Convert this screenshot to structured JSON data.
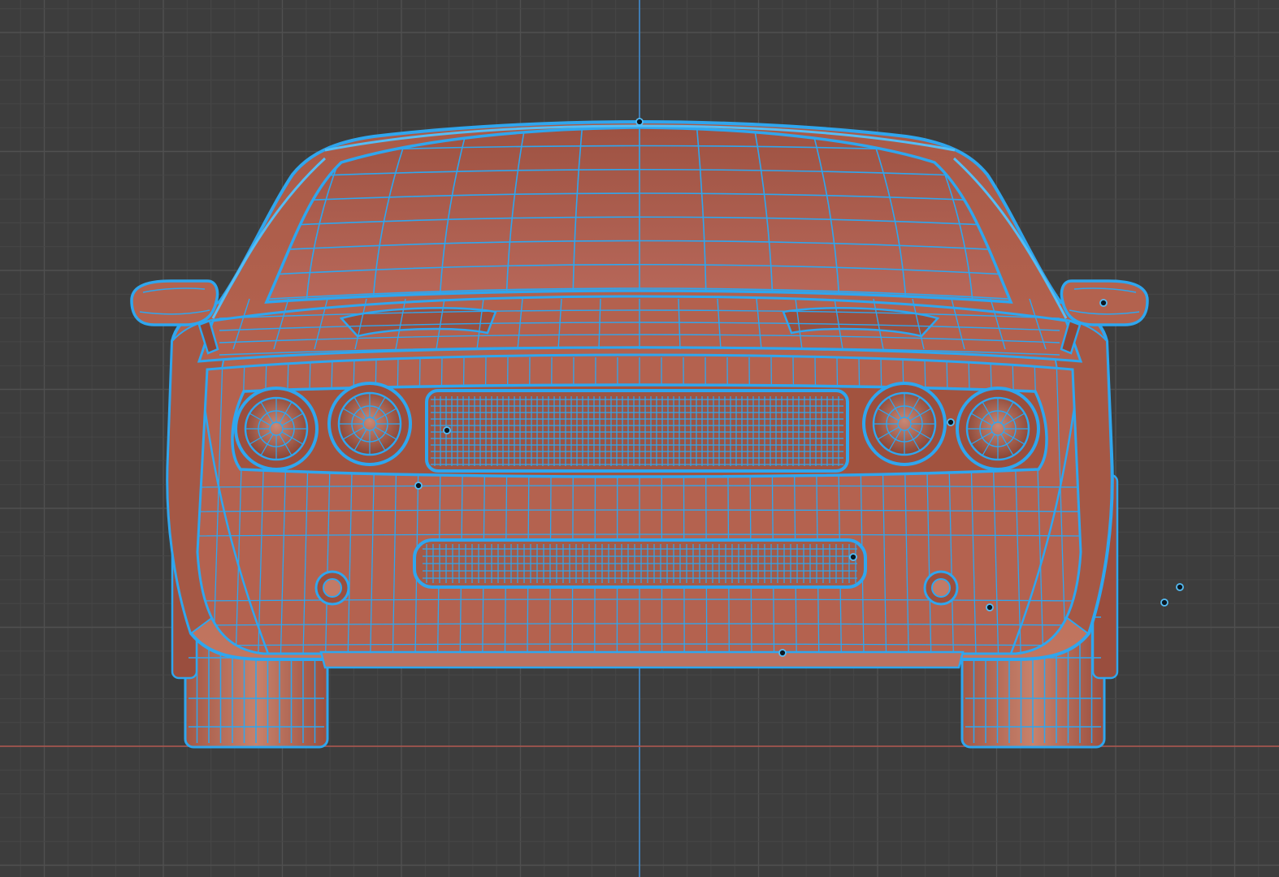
{
  "viewport": {
    "mode": "front-orthographic",
    "shading": "solid-with-wireframe-overlay",
    "grid": true
  },
  "colors": {
    "background": "#3d3d3d",
    "grid_minor": "#474747",
    "grid_major": "#505050",
    "axis_x": "#b0574f",
    "axis_z": "#3f8fd6",
    "wireframe": "#2fa6ee",
    "wire_light": "#54bdf5",
    "body": "#b0604d",
    "body_dark": "#8d4636",
    "body_light": "#c9806b",
    "vertex": "#0b1822"
  },
  "model": {
    "object": "muscle-car",
    "view": "front"
  }
}
